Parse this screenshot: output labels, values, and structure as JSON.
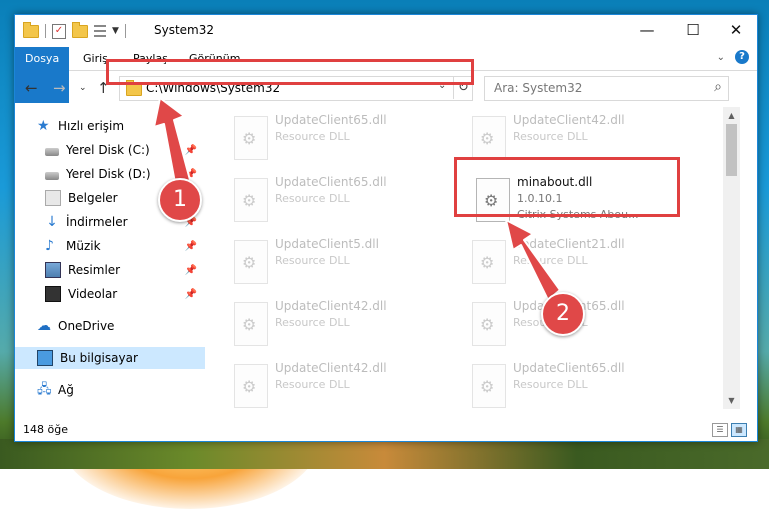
{
  "window": {
    "title": "System32",
    "minimize_icon": "minimize-icon",
    "maximize_icon": "maximize-icon",
    "close_icon": "close-icon"
  },
  "ribbon": {
    "tabs": [
      {
        "label": "Dosya"
      },
      {
        "label": "Giriş"
      },
      {
        "label": "Paylaş"
      },
      {
        "label": "Görünüm"
      }
    ]
  },
  "address": {
    "path": "C:\\Windows\\System32",
    "search_placeholder": "Ara: System32"
  },
  "sidebar": {
    "items": [
      {
        "label": "Hızlı erişim",
        "icon": "star-icon",
        "pinned": false
      },
      {
        "label": "Yerel Disk (C:)",
        "icon": "disk-icon",
        "pinned": true
      },
      {
        "label": "Yerel Disk (D:)",
        "icon": "disk-icon",
        "pinned": true
      },
      {
        "label": "Belgeler",
        "icon": "documents-icon",
        "pinned": true
      },
      {
        "label": "İndirmeler",
        "icon": "downloads-icon",
        "pinned": true
      },
      {
        "label": "Müzik",
        "icon": "music-icon",
        "pinned": true
      },
      {
        "label": "Resimler",
        "icon": "pictures-icon",
        "pinned": true
      },
      {
        "label": "Videolar",
        "icon": "videos-icon",
        "pinned": true
      },
      {
        "label": "OneDrive",
        "icon": "onedrive-icon",
        "pinned": false
      },
      {
        "label": "Bu bilgisayar",
        "icon": "this-pc-icon",
        "pinned": false
      },
      {
        "label": "Ağ",
        "icon": "network-icon",
        "pinned": false
      }
    ]
  },
  "files": [
    {
      "name": "UpdateClient65.dll",
      "desc": "Resource DLL"
    },
    {
      "name": "UpdateClient42.dll",
      "desc": "Resource DLL"
    },
    {
      "name": "UpdateClient65.dll",
      "desc": "Resource DLL"
    },
    {
      "name": "minabout.dll",
      "desc": "1.0.10.1",
      "desc2": "Citrix Systems Abou..."
    },
    {
      "name": "UpdateClient5.dll",
      "desc": "Resource DLL"
    },
    {
      "name": "UpdateClient21.dll",
      "desc": "Resource DLL"
    },
    {
      "name": "UpdateClient42.dll",
      "desc": "Resource DLL"
    },
    {
      "name": "UpdateClient65.dll",
      "desc": "Resource DLL"
    },
    {
      "name": "UpdateClient42.dll",
      "desc": "Resource DLL"
    },
    {
      "name": "UpdateClient65.dll",
      "desc": "Resource DLL"
    }
  ],
  "status": {
    "item_count": "148 öğe"
  },
  "annotations": {
    "step1": "1",
    "step2": "2",
    "color": "#e04848"
  }
}
